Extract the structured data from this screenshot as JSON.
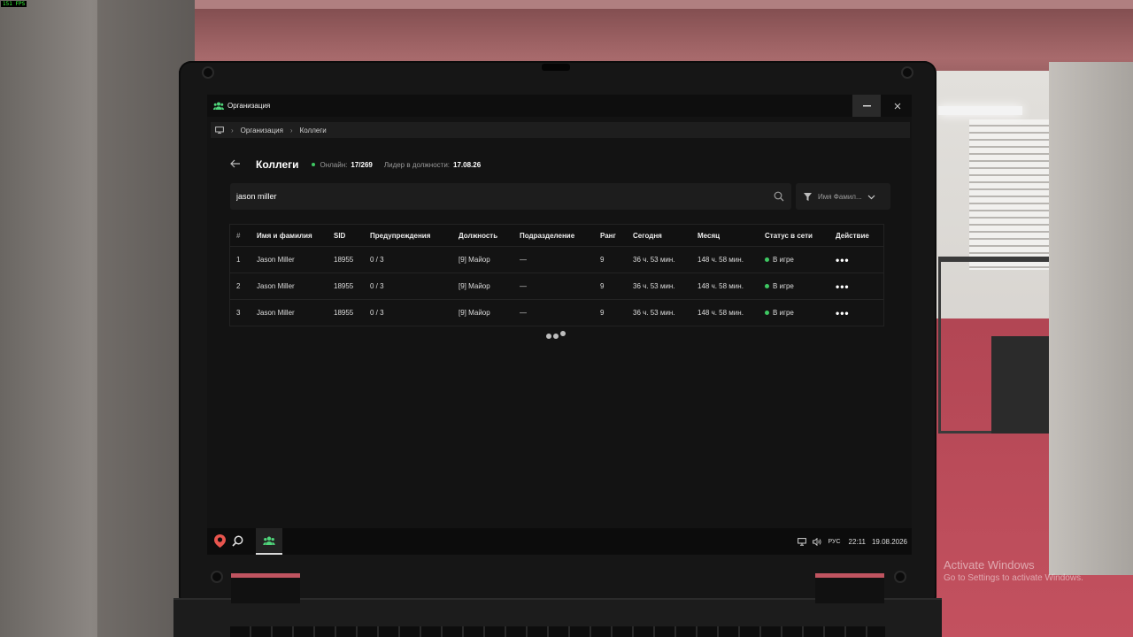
{
  "fps": "151 FPS",
  "window": {
    "title": "Организация",
    "icon": "people-icon"
  },
  "breadcrumb": {
    "home_icon": "monitor-icon",
    "items": [
      "Организация",
      "Коллеги"
    ]
  },
  "header": {
    "title": "Коллеги",
    "online_label": "Онлайн:",
    "online_value": "17/269",
    "leader_label": "Лидер в должности:",
    "leader_value": "17.08.26"
  },
  "search": {
    "value": "jason miller",
    "icon": "search-icon"
  },
  "filter": {
    "label": "Имя Фамил...",
    "icon": "funnel-icon"
  },
  "table": {
    "headers": [
      "#",
      "Имя и фамилия",
      "SID",
      "Предупреждения",
      "Должность",
      "Подразделение",
      "Ранг",
      "Сегодня",
      "Месяц",
      "Статус в сети",
      "Действие"
    ],
    "rows": [
      {
        "num": "1",
        "name": "Jason Miller",
        "sid": "18955",
        "warnings": "0 / 3",
        "position": "[9] Майор",
        "division": "—",
        "rank": "9",
        "today": "36 ч. 53 мин.",
        "month": "148 ч. 58 мин.",
        "status": "В игре",
        "action": "•••"
      },
      {
        "num": "2",
        "name": "Jason Miller",
        "sid": "18955",
        "warnings": "0 / 3",
        "position": "[9] Майор",
        "division": "—",
        "rank": "9",
        "today": "36 ч. 53 мин.",
        "month": "148 ч. 58 мин.",
        "status": "В игре",
        "action": "•••"
      },
      {
        "num": "3",
        "name": "Jason Miller",
        "sid": "18955",
        "warnings": "0 / 3",
        "position": "[9] Майор",
        "division": "—",
        "rank": "9",
        "today": "36 ч. 53 мин.",
        "month": "148 ч. 58 мин.",
        "status": "В игре",
        "action": "•••"
      }
    ]
  },
  "taskbar": {
    "language": "РУС",
    "time": "22:11",
    "date": "19.08.2026"
  },
  "watermark": {
    "title": "Activate Windows",
    "subtitle": "Go to Settings to activate Windows."
  },
  "colors": {
    "online": "#3ec862",
    "accent_icon": "#4fd47a",
    "logo": "#e8554e"
  }
}
